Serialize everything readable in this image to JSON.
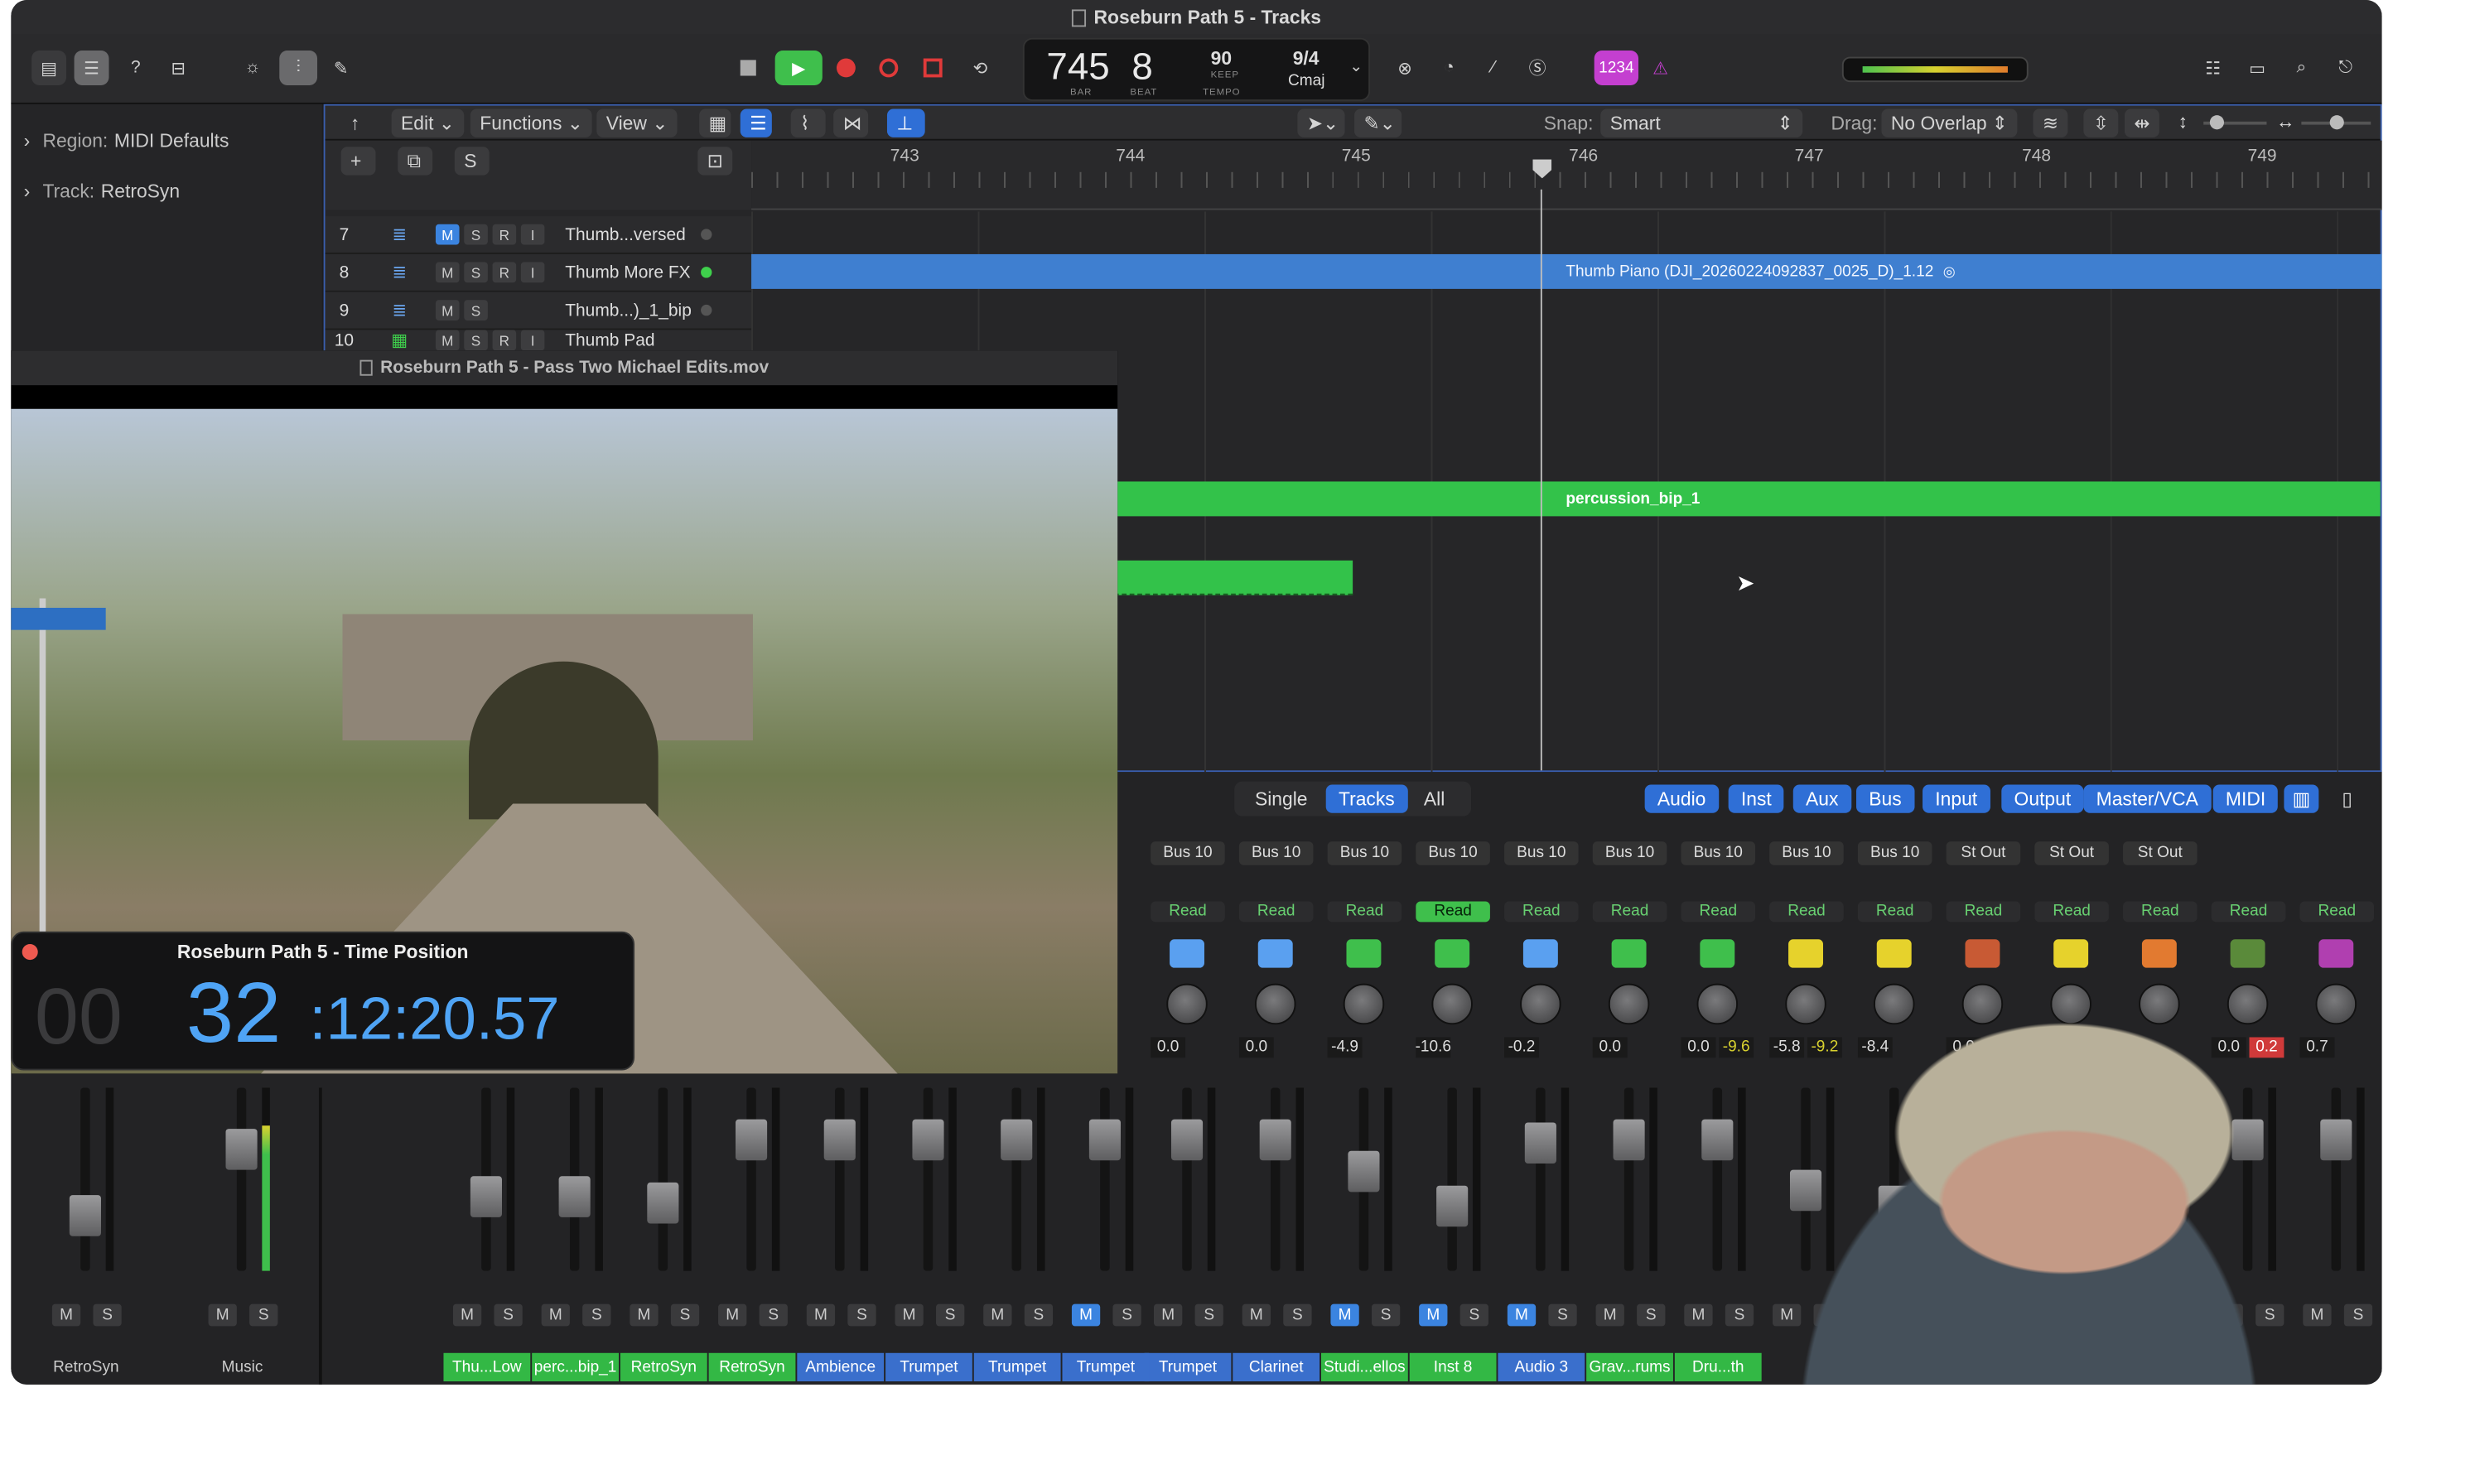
{
  "window": {
    "title": "Roseburn Path 5 - Tracks"
  },
  "transport": {
    "bar": "745",
    "beat": "8",
    "bar_label": "BAR",
    "beat_label": "BEAT",
    "tempo": "90",
    "tempo_label": "KEEP",
    "tempo_sub": "TEMPO",
    "signature": "9/4",
    "key": "Cmaj",
    "counter_badge": "1234"
  },
  "inspector": {
    "region_label": "Region:",
    "region_value": "MIDI Defaults",
    "track_label": "Track:",
    "track_value": "RetroSyn"
  },
  "tracks_menu": [
    "Edit",
    "Functions",
    "View"
  ],
  "snap": {
    "label": "Snap:",
    "value": "Smart"
  },
  "drag": {
    "label": "Drag:",
    "value": "No Overlap"
  },
  "ruler": [
    "743",
    "744",
    "745",
    "746",
    "747",
    "748",
    "749"
  ],
  "track_list": [
    {
      "num": "7",
      "name": "Thumb...versed",
      "buttons": [
        "M",
        "S",
        "R",
        "I"
      ]
    },
    {
      "num": "8",
      "name": "Thumb More FX",
      "buttons": [
        "M",
        "S",
        "R",
        "I"
      ]
    },
    {
      "num": "9",
      "name": "Thumb...)_1_bip",
      "buttons": [
        "M",
        "S"
      ]
    },
    {
      "num": "10",
      "name": "Thumb Pad",
      "buttons": [
        "M",
        "S",
        "R",
        "I"
      ]
    }
  ],
  "regions": {
    "blue": "Thumb Piano (DJI_20260224092837_0025_D)_1.12",
    "green": "percussion_bip_1"
  },
  "video": {
    "title": "Roseburn Path 5 - Pass Two Michael Edits.mov"
  },
  "time_position": {
    "title": "Roseburn Path 5 - Time Position",
    "hours": "00",
    "minutes": "32",
    "rest": ":12:20.57"
  },
  "mixer_tabs": {
    "single": "Single",
    "tracks": "Tracks",
    "all": "All"
  },
  "mixer_filters": [
    "Audio",
    "Inst",
    "Aux",
    "Bus",
    "Input",
    "Output",
    "Master/VCA",
    "MIDI"
  ],
  "mixer_left": [
    {
      "name": "RetroSyn",
      "m": "M",
      "s": "S"
    },
    {
      "name": "Music",
      "m": "M",
      "s": "S"
    }
  ],
  "mixer_strips": [
    {
      "bus": "Bus 10",
      "read": "Read",
      "val": "0.0",
      "val2": "",
      "name": "Trumpet",
      "mute": false
    },
    {
      "bus": "Bus 10",
      "read": "Read",
      "val": "0.0",
      "val2": "",
      "name": "Clarinet",
      "mute": false
    },
    {
      "bus": "Bus 10",
      "read": "Read",
      "val": "-4.9",
      "val2": "",
      "name": "Studi...ellos",
      "mute": true
    },
    {
      "bus": "Bus 10",
      "read": "Read",
      "val": "-10.6",
      "val2": "",
      "name": "Inst 8",
      "mute": true
    },
    {
      "bus": "Bus 10",
      "read": "Read",
      "val": "-0.2",
      "val2": "",
      "name": "Audio 3",
      "mute": true
    },
    {
      "bus": "Bus 10",
      "read": "Read",
      "val": "0.0",
      "val2": "",
      "name": "Grav...rums",
      "mute": false
    },
    {
      "bus": "Bus 10",
      "read": "Read",
      "val": "0.0",
      "val2": "-9.6",
      "name": "Dru...th",
      "mute": false
    },
    {
      "bus": "Bus 10",
      "read": "Read",
      "val": "-5.8",
      "val2": "-9.2",
      "name": "",
      "mute": false
    },
    {
      "bus": "Bus 10",
      "read": "Read",
      "val": "-8.4",
      "val2": "",
      "name": "",
      "mute": false
    },
    {
      "bus": "St Out",
      "read": "Read",
      "val": "0.0",
      "val2": "",
      "name": "",
      "mute": false
    },
    {
      "bus": "St Out",
      "read": "Read",
      "val": "",
      "val2": "",
      "name": "",
      "mute": false
    },
    {
      "bus": "St Out",
      "read": "Read",
      "val": "",
      "val2": "",
      "name": "",
      "mute": false
    },
    {
      "bus": "",
      "read": "Read",
      "val": "0.0",
      "val2": "0.2",
      "name": "",
      "mute": false
    },
    {
      "bus": "",
      "read": "Read",
      "val": "0.7",
      "val2": "",
      "name": "",
      "mute": false
    }
  ],
  "mixer_names_under_video": [
    "Thu...Low",
    "perc...bip_1",
    "RetroSyn",
    "RetroSyn",
    "Ambience",
    "Trumpet",
    "Trumpet",
    "Trumpet"
  ],
  "colors": {
    "accent": "#2f6fd6",
    "green": "#33c24a",
    "blue_region": "#3f7fd0",
    "badge": "#c43fd0"
  }
}
